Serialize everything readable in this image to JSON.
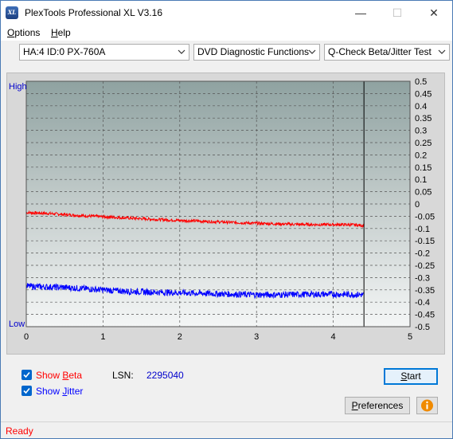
{
  "window": {
    "title": "PlexTools Professional XL V3.16",
    "app_icon_text": "XL",
    "minimize_glyph": "—",
    "maximize_glyph": "☐",
    "close_glyph": "✕"
  },
  "menu": {
    "options": {
      "underlined": "O",
      "rest": "ptions"
    },
    "help": {
      "underlined": "H",
      "rest": "elp"
    }
  },
  "toolbar": {
    "drive": "HA:4 ID:0  PX-760A",
    "function": "DVD Diagnostic Functions",
    "test": "Q-Check Beta/Jitter Test"
  },
  "chart_data": {
    "type": "line",
    "title": "",
    "xlabel": "",
    "ylabel": "",
    "left_axis_top_label": "High",
    "left_axis_bottom_label": "Low",
    "xlim": [
      0,
      5
    ],
    "ylim": [
      -0.5,
      0.5
    ],
    "x_ticks": [
      "0",
      "1",
      "2",
      "3",
      "4",
      "5"
    ],
    "y_ticks": [
      "0.5",
      "0.45",
      "0.4",
      "0.35",
      "0.3",
      "0.25",
      "0.2",
      "0.15",
      "0.1",
      "0.05",
      "0",
      "-0.05",
      "-0.1",
      "-0.15",
      "-0.2",
      "-0.25",
      "-0.3",
      "-0.35",
      "-0.4",
      "-0.45",
      "-0.5"
    ],
    "end_marker_x": 4.4,
    "grid": true,
    "series": [
      {
        "name": "Beta",
        "color": "#ff0000",
        "x": [
          0,
          0.25,
          0.5,
          0.75,
          1.0,
          1.25,
          1.5,
          1.75,
          2.0,
          2.25,
          2.5,
          2.75,
          3.0,
          3.25,
          3.5,
          3.75,
          4.0,
          4.25,
          4.4
        ],
        "y": [
          -0.035,
          -0.038,
          -0.043,
          -0.048,
          -0.052,
          -0.056,
          -0.06,
          -0.064,
          -0.067,
          -0.07,
          -0.073,
          -0.076,
          -0.079,
          -0.081,
          -0.083,
          -0.084,
          -0.084,
          -0.085,
          -0.088
        ]
      },
      {
        "name": "Jitter",
        "color": "#0000ff",
        "x": [
          0,
          0.25,
          0.5,
          0.75,
          1.0,
          1.25,
          1.5,
          1.75,
          2.0,
          2.25,
          2.5,
          2.75,
          3.0,
          3.25,
          3.5,
          3.75,
          4.0,
          4.25,
          4.4
        ],
        "y": [
          -0.335,
          -0.338,
          -0.34,
          -0.345,
          -0.35,
          -0.355,
          -0.358,
          -0.36,
          -0.362,
          -0.364,
          -0.366,
          -0.368,
          -0.37,
          -0.37,
          -0.369,
          -0.368,
          -0.368,
          -0.369,
          -0.37
        ]
      }
    ]
  },
  "controls": {
    "show_beta": {
      "label": "Show ",
      "underlined": "B",
      "rest": "eta",
      "checked": true,
      "color": "#ff0000"
    },
    "show_jitter": {
      "label": "Show ",
      "underlined": "J",
      "rest": "itter",
      "checked": true,
      "color": "#0000ff"
    },
    "lsn_label": "LSN:",
    "lsn_value": "2295040",
    "start_button": {
      "underlined": "S",
      "rest": "tart"
    },
    "preferences_button": {
      "underlined": "P",
      "rest": "references"
    },
    "info_icon": "info-icon"
  },
  "status": {
    "text": "Ready"
  }
}
